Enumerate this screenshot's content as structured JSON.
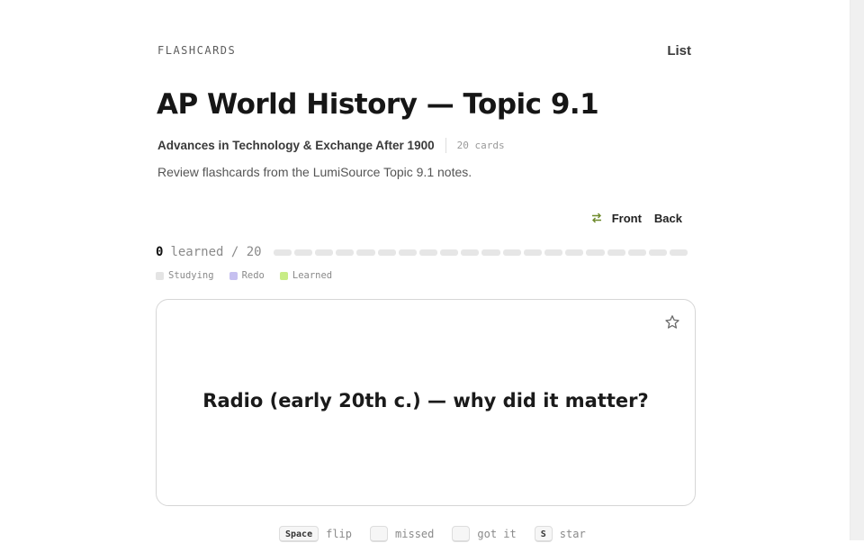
{
  "header": {
    "section_label": "FLASHCARDS",
    "list_link": "List"
  },
  "deck": {
    "title": "AP World History — Topic 9.1",
    "subtitle": "Advances in Technology & Exchange After 1900",
    "card_count": "20 cards",
    "description": "Review flashcards from the LumiSource Topic 9.1 notes."
  },
  "face_toggle": {
    "front": "Front",
    "back": "Back",
    "icon": "swap-icon"
  },
  "progress": {
    "learned": 0,
    "total_label": "learned / 20",
    "total": 20
  },
  "legend": [
    {
      "label": "Studying",
      "color": "#e4e4e4"
    },
    {
      "label": "Redo",
      "color": "#c6c0f0"
    },
    {
      "label": "Learned",
      "color": "#c8ec86"
    }
  ],
  "card": {
    "prompt": "Radio (early 20th c.) — why did it matter?",
    "star_icon": "star-icon"
  },
  "shortcuts": [
    {
      "key": "Space",
      "label": "flip"
    },
    {
      "key": "",
      "label": "missed"
    },
    {
      "key": "",
      "label": "got it"
    },
    {
      "key": "S",
      "label": "star"
    }
  ],
  "colors": {
    "accent": "#6e8a2c",
    "border": "#d6d6d6",
    "segment": "#e6e6e6"
  }
}
